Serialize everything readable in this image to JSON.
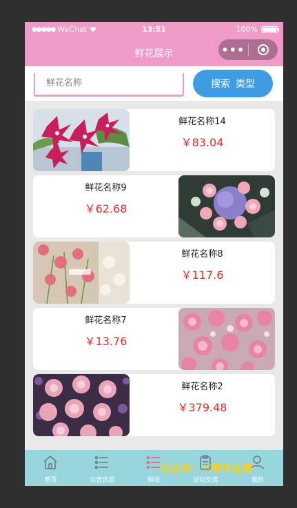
{
  "status_bar": {
    "carrier": "WeChat",
    "time": "13:51",
    "battery": "100%"
  },
  "nav": {
    "title": "鲜花展示"
  },
  "search": {
    "placeholder": "鲜花名称",
    "value": "",
    "search_label": "搜索",
    "type_label": "类型"
  },
  "flowers": [
    {
      "name": "鲜花名称14",
      "price": "￥83.04"
    },
    {
      "name": "鲜花名称9",
      "price": "￥62.68"
    },
    {
      "name": "鲜花名称8",
      "price": "￥117.6"
    },
    {
      "name": "鲜花名称7",
      "price": "￥13.76"
    },
    {
      "name": "鲜花名称2",
      "price": "￥379.48"
    }
  ],
  "tabs": [
    {
      "label": "首页",
      "icon": "home-icon"
    },
    {
      "label": "公告信息",
      "icon": "list-icon"
    },
    {
      "label": "鲜花",
      "icon": "list-icon"
    },
    {
      "label": "论坛交流",
      "icon": "clipboard-icon"
    },
    {
      "label": "我的",
      "icon": "user-icon"
    }
  ],
  "watermark": "公众号：二哥毕业哥",
  "colors": {
    "header": "#f09ac8",
    "search_button": "#3f9be2",
    "price": "#e32929",
    "tab_bar": "#96d6dc",
    "active_tab_icon": "#e8627a"
  }
}
